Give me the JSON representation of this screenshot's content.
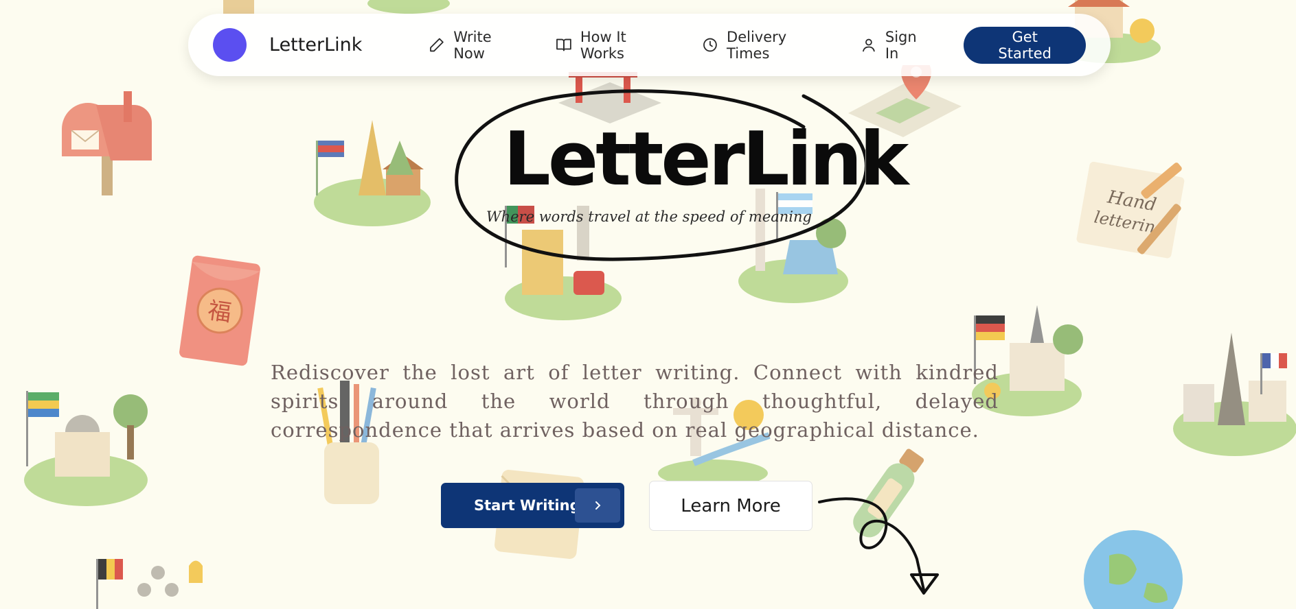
{
  "nav": {
    "brand": "LetterLink",
    "links": [
      {
        "label": "Write Now",
        "icon": "pencil-icon"
      },
      {
        "label": "How It Works",
        "icon": "book-icon"
      },
      {
        "label": "Delivery Times",
        "icon": "clock-icon"
      },
      {
        "label": "Sign In",
        "icon": "user-icon"
      }
    ],
    "cta_label": "Get Started"
  },
  "hero": {
    "title": "LetterLink",
    "tagline": "Where words travel at the speed of meaning",
    "intro": "Rediscover the lost art of letter writing. Connect with kindred spirits around the world through thoughtful, delayed correspondence that arrives based on real geographical distance.",
    "primary_button": "Start Writing",
    "secondary_button": "Learn More"
  },
  "decorations": {
    "stamp_text": "福",
    "card_text": "Hand lettering"
  },
  "colors": {
    "background": "#fdfcf0",
    "accent": "#0e3576",
    "logo": "#5b4ff0"
  }
}
